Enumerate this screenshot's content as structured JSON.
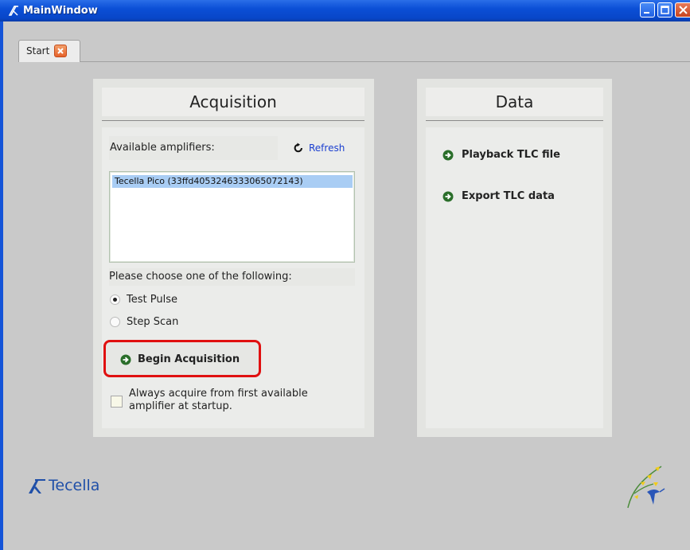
{
  "window": {
    "title": "MainWindow"
  },
  "tabs": [
    {
      "label": "Start"
    }
  ],
  "acquisition": {
    "heading": "Acquisition",
    "amplifiers_label": "Available amplifiers:",
    "refresh_label": "Refresh",
    "amplifiers": [
      "Tecella Pico (33ffd4053246333065072143)"
    ],
    "choose_label": "Please choose one of the following:",
    "options": [
      {
        "label": "Test Pulse",
        "selected": true
      },
      {
        "label": "Step Scan",
        "selected": false
      }
    ],
    "begin_label": "Begin Acquisition",
    "auto_acquire_label": "Always acquire from first available amplifier at startup.",
    "auto_acquire_checked": false
  },
  "data": {
    "heading": "Data",
    "links": [
      "Playback TLC file",
      "Export TLC data"
    ]
  },
  "branding": {
    "logo_text": "Tecella"
  },
  "colors": {
    "titlebar": "#0b4fd6",
    "highlight": "#e01010",
    "link": "#1b3fd0",
    "selection": "#a9cdf4",
    "go_icon": "#2a6e2a"
  }
}
